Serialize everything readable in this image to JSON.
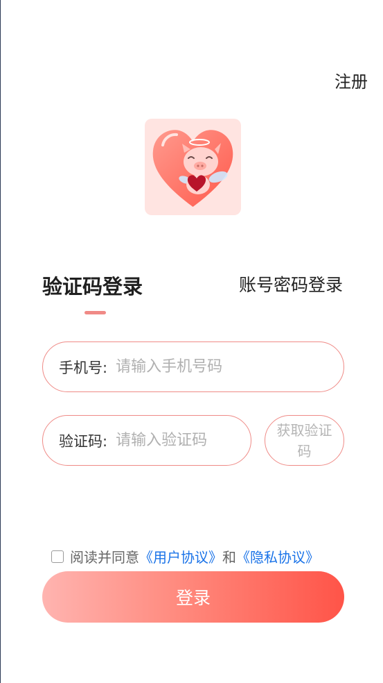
{
  "header": {
    "register_label": "注册"
  },
  "logo": {
    "icon": "heart-pig-logo-icon",
    "background": "#ffe4e1"
  },
  "tabs": {
    "sms_login": "验证码登录",
    "password_login": "账号密码登录",
    "active": "sms_login"
  },
  "form": {
    "phone": {
      "label": "手机号:",
      "placeholder": "请输入手机号码",
      "value": ""
    },
    "code": {
      "label": "验证码:",
      "placeholder": "请输入验证码",
      "value": ""
    },
    "get_code_label": "获取验证码"
  },
  "agreement": {
    "checked": false,
    "prefix": "阅读并同意",
    "user_agreement": "《用户协议》",
    "conjunction": "和",
    "privacy_agreement": "《隐私协议》"
  },
  "login_button_label": "登录",
  "colors": {
    "accent": "#ef8a86",
    "link": "#1a73e8",
    "button_gradient_start": "#ffb4b0",
    "button_gradient_end": "#ff5448"
  }
}
